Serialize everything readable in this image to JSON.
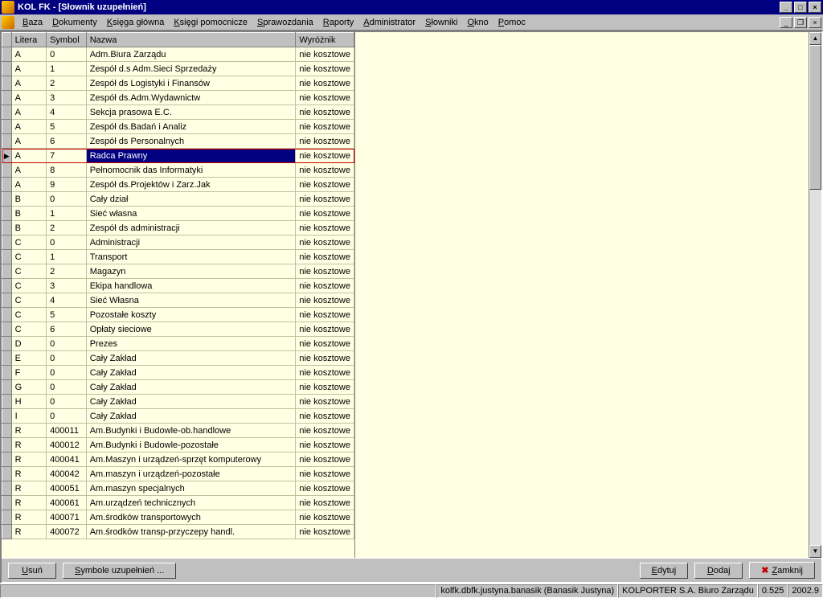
{
  "title": "KOL FK - [Słownik uzupełnień]",
  "menu": [
    "Baza",
    "Dokumenty",
    "Księga główna",
    "Księgi pomocnicze",
    "Sprawozdania",
    "Raporty",
    "Administrator",
    "Słowniki",
    "Okno",
    "Pomoc"
  ],
  "columns": {
    "litera": "Litera",
    "symbol": "Symbol",
    "nazwa": "Nazwa",
    "wyroznik": "Wyróżnik"
  },
  "selected_index": 7,
  "rows": [
    {
      "l": "A",
      "s": "0",
      "n": "Adm.Biura Zarządu",
      "w": "nie kosztowe"
    },
    {
      "l": "A",
      "s": "1",
      "n": "Zespół d.s Adm.Sieci Sprzedaży",
      "w": "nie kosztowe"
    },
    {
      "l": "A",
      "s": "2",
      "n": "Zespół ds Logistyki i Finansów",
      "w": "nie kosztowe"
    },
    {
      "l": "A",
      "s": "3",
      "n": "Zespół ds.Adm.Wydawnictw",
      "w": "nie kosztowe"
    },
    {
      "l": "A",
      "s": "4",
      "n": "Sekcja prasowa E.C.",
      "w": "nie kosztowe"
    },
    {
      "l": "A",
      "s": "5",
      "n": "Zespół ds.Badań i Analiz",
      "w": "nie kosztowe"
    },
    {
      "l": "A",
      "s": "6",
      "n": "Zespół ds Personalnych",
      "w": "nie kosztowe"
    },
    {
      "l": "A",
      "s": "7",
      "n": "Radca Prawny",
      "w": "nie kosztowe"
    },
    {
      "l": "A",
      "s": "8",
      "n": "Pełnomocnik das Informatyki",
      "w": "nie kosztowe"
    },
    {
      "l": "A",
      "s": "9",
      "n": "Zespół ds.Projektów i Zarz.Jak",
      "w": "nie kosztowe"
    },
    {
      "l": "B",
      "s": "0",
      "n": "Cały dział",
      "w": "nie kosztowe"
    },
    {
      "l": "B",
      "s": "1",
      "n": "Sieć własna",
      "w": "nie kosztowe"
    },
    {
      "l": "B",
      "s": "2",
      "n": "Zespół ds  administracji",
      "w": "nie kosztowe"
    },
    {
      "l": "C",
      "s": "0",
      "n": "Administracji",
      "w": "nie kosztowe"
    },
    {
      "l": "C",
      "s": "1",
      "n": "Transport",
      "w": "nie kosztowe"
    },
    {
      "l": "C",
      "s": "2",
      "n": "Magazyn",
      "w": "nie kosztowe"
    },
    {
      "l": "C",
      "s": "3",
      "n": "Ekipa handlowa",
      "w": "nie kosztowe"
    },
    {
      "l": "C",
      "s": "4",
      "n": "Sieć Własna",
      "w": "nie kosztowe"
    },
    {
      "l": "C",
      "s": "5",
      "n": "Pozostałe koszty",
      "w": "nie kosztowe"
    },
    {
      "l": "C",
      "s": "6",
      "n": "Opłaty sieciowe",
      "w": "nie kosztowe"
    },
    {
      "l": "D",
      "s": "0",
      "n": "Prezes",
      "w": "nie kosztowe"
    },
    {
      "l": "E",
      "s": "0",
      "n": "Cały Zakład",
      "w": "nie kosztowe"
    },
    {
      "l": "F",
      "s": "0",
      "n": "Cały Zakład",
      "w": "nie kosztowe"
    },
    {
      "l": "G",
      "s": "0",
      "n": "Cały Zakład",
      "w": "nie kosztowe"
    },
    {
      "l": "H",
      "s": "0",
      "n": "Cały Zakład",
      "w": "nie kosztowe"
    },
    {
      "l": "I",
      "s": "0",
      "n": "Cały Zakład",
      "w": "nie kosztowe"
    },
    {
      "l": "R",
      "s": "400011",
      "n": "Am.Budynki i Budowle-ob.handlowe",
      "w": "nie kosztowe"
    },
    {
      "l": "R",
      "s": "400012",
      "n": "Am.Budynki i Budowle-pozostałe",
      "w": "nie kosztowe"
    },
    {
      "l": "R",
      "s": "400041",
      "n": "Am.Maszyn i urządzeń-sprzęt komputerowy",
      "w": "nie kosztowe"
    },
    {
      "l": "R",
      "s": "400042",
      "n": "Am.maszyn i urządzeń-pozostałe",
      "w": "nie kosztowe"
    },
    {
      "l": "R",
      "s": "400051",
      "n": "Am.maszyn specjalnych",
      "w": "nie kosztowe"
    },
    {
      "l": "R",
      "s": "400061",
      "n": "Am.urządzeń technicznych",
      "w": "nie kosztowe"
    },
    {
      "l": "R",
      "s": "400071",
      "n": "Am.środków transportowych",
      "w": "nie kosztowe"
    },
    {
      "l": "R",
      "s": "400072",
      "n": "Am.środków transp-przyczepy handl.",
      "w": "nie kosztowe"
    }
  ],
  "buttons": {
    "usun": "Usuń",
    "symbole": "Symbole uzupełnień ...",
    "edytuj": "Edytuj",
    "dodaj": "Dodaj",
    "zamknij": "Zamknij"
  },
  "status": {
    "db": "kolfk.dbfk.justyna.banasik (Banasik Justyna)",
    "firm": "KOLPORTER S.A. Biuro Zarządu",
    "num": "0.525",
    "ver": "2002.9"
  }
}
